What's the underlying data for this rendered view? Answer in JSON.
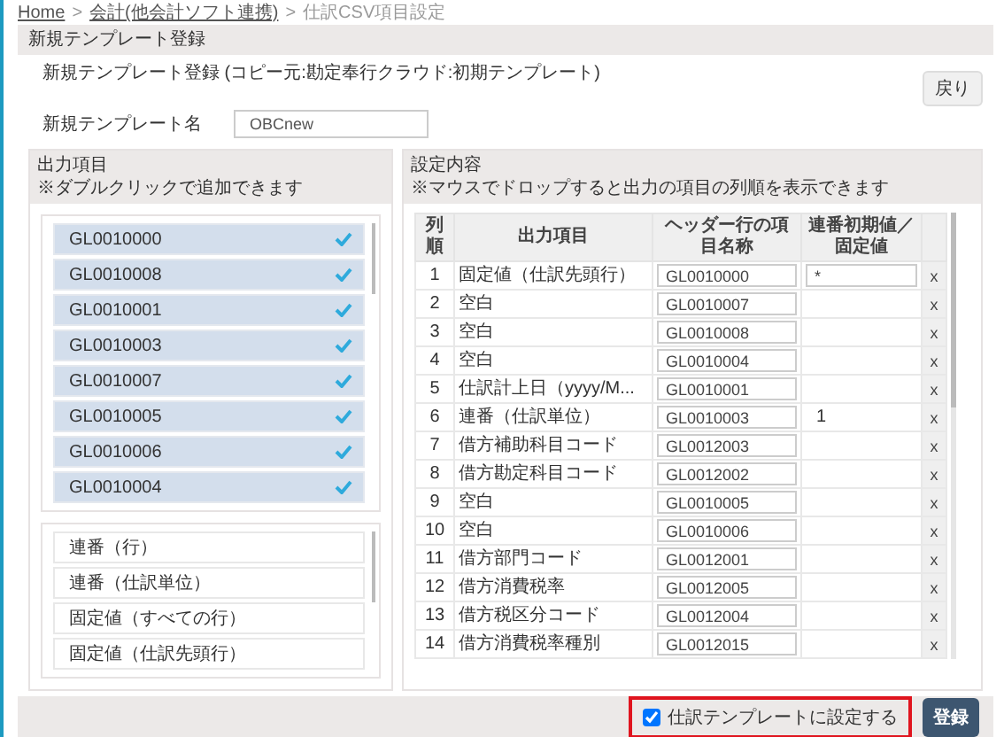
{
  "breadcrumb": [
    {
      "label": "Home",
      "link": true
    },
    {
      "label": ">",
      "link": false
    },
    {
      "label": "会計(他会計ソフト連携)",
      "link": true
    },
    {
      "label": ">",
      "link": false
    },
    {
      "label": "仕訳CSV項目設定",
      "link": false
    }
  ],
  "form": {
    "title": "新規テンプレート登録",
    "source": "新規テンプレート登録 (コピー元:勘定奉行クラウド:初期テンプレート)",
    "back_button": "戻り",
    "name_label": "新規テンプレート名",
    "name_value": "OBCnew"
  },
  "output_items": {
    "title": "出力項目",
    "hint": "※ダブルクリックで追加できます",
    "codes": [
      {
        "label": "GL0010000",
        "checked": true
      },
      {
        "label": "GL0010008",
        "checked": true
      },
      {
        "label": "GL0010001",
        "checked": true
      },
      {
        "label": "GL0010003",
        "checked": true
      },
      {
        "label": "GL0010007",
        "checked": true
      },
      {
        "label": "GL0010005",
        "checked": true
      },
      {
        "label": "GL0010006",
        "checked": true
      },
      {
        "label": "GL0010004",
        "checked": true
      }
    ],
    "special": [
      "連番（行）",
      "連番（仕訳単位）",
      "固定値（すべての行）",
      "固定値（仕訳先頭行）"
    ]
  },
  "settings": {
    "title": "設定内容",
    "hint": "※マウスでドロップすると出力の項目の列順を表示できます",
    "columns": [
      "列順",
      "出力項目",
      "ヘッダー行の項目名称",
      "連番初期値／固定値"
    ],
    "rows": [
      {
        "no": "1",
        "item": "固定値（仕訳先頭行）",
        "header": "GL0010000",
        "initial": {
          "kind": "field",
          "value": "*"
        },
        "delete": "x"
      },
      {
        "no": "2",
        "item": "空白",
        "header": "GL0010007",
        "delete": "x"
      },
      {
        "no": "3",
        "item": "空白",
        "header": "GL0010008",
        "delete": "x"
      },
      {
        "no": "4",
        "item": "空白",
        "header": "GL0010004",
        "delete": "x"
      },
      {
        "no": "5",
        "item": "仕訳計上日（yyyy/M...",
        "header": "GL0010001",
        "delete": "x"
      },
      {
        "no": "6",
        "item": "連番（仕訳単位）",
        "header": "GL0010003",
        "initial": {
          "kind": "text",
          "value": "1"
        },
        "delete": "x"
      },
      {
        "no": "7",
        "item": "借方補助科目コード",
        "header": "GL0012003",
        "delete": "x"
      },
      {
        "no": "8",
        "item": "借方勘定科目コード",
        "header": "GL0012002",
        "delete": "x"
      },
      {
        "no": "9",
        "item": "空白",
        "header": "GL0010005",
        "delete": "x"
      },
      {
        "no": "10",
        "item": "空白",
        "header": "GL0010006",
        "delete": "x"
      },
      {
        "no": "11",
        "item": "借方部門コード",
        "header": "GL0012001",
        "delete": "x"
      },
      {
        "no": "12",
        "item": "借方消費税率",
        "header": "GL0012005",
        "delete": "x"
      },
      {
        "no": "13",
        "item": "借方税区分コード",
        "header": "GL0012004",
        "delete": "x"
      },
      {
        "no": "14",
        "item": "借方消費税率種別",
        "header": "GL0012015",
        "delete": "x"
      }
    ]
  },
  "footer": {
    "template_checkbox": {
      "label": "仕訳テンプレートに設定する",
      "checked": true
    },
    "register_button": "登録"
  }
}
